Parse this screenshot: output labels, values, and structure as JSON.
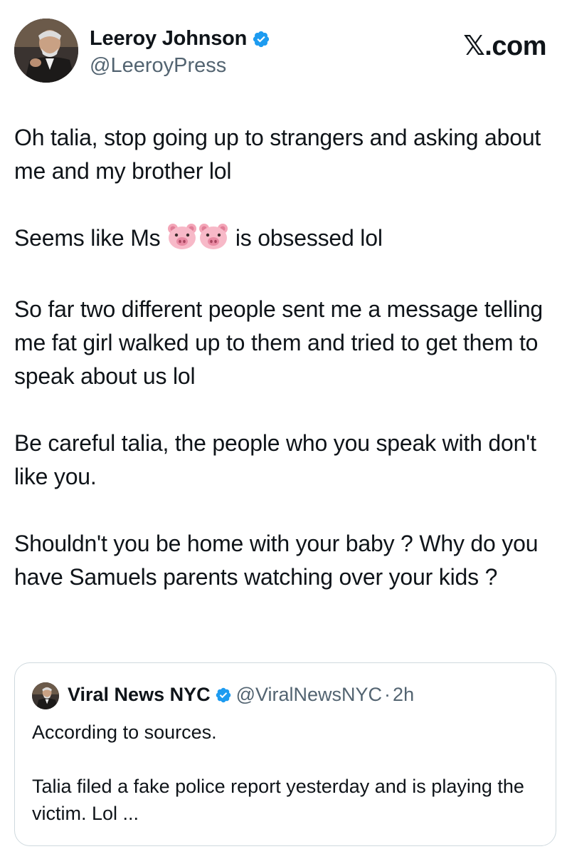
{
  "tweet": {
    "author_name": "Leeroy Johnson",
    "author_handle": "@LeeroyPress",
    "brand": "𝕏.com",
    "paragraphs": {
      "p1": "Oh talia, stop going up to strangers and asking about me and my brother lol",
      "p2_before": "Seems like Ms ",
      "p2_after": " is obsessed lol",
      "p3": "So far two different people sent me a message telling me fat girl walked up to them and tried to get them to speak about us lol",
      "p4": "Be careful talia, the people who you speak with don't like you.",
      "p5": "Shouldn't you be home with your baby ? Why do you have Samuels parents watching over your kids ?"
    },
    "emoji": "pig-face-icon"
  },
  "quoted": {
    "author_name": "Viral News NYC",
    "author_handle": "@ViralNewsNYC",
    "separator": "·",
    "time": "2h",
    "line1": "According to sources.",
    "line2": "Talia filed a fake police report yesterday and is playing the victim. Lol ..."
  },
  "colors": {
    "verified": "#1d9bf0",
    "handle": "#536471",
    "border": "#cfd9de"
  }
}
